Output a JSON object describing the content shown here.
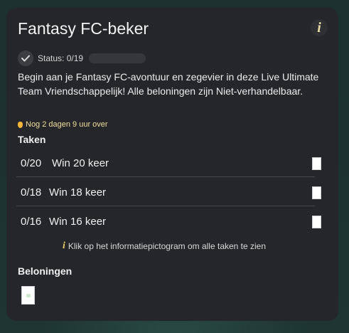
{
  "header": {
    "title": "Fantasy FC-beker",
    "info_icon": "i"
  },
  "status": {
    "label": "Status: 0/19",
    "progress_fraction": 0
  },
  "description": "Begin aan je Fantasy FC-avontuur en zegevier in deze Live Ultimate Team Vriendschappelijk! Alle beloningen zijn Niet-verhandelbaar.",
  "timer": {
    "text": "Nog 2 dagen 9 uur over"
  },
  "tasks": {
    "heading": "Taken",
    "items": [
      {
        "progress": "0/20",
        "name": "Win 20 keer"
      },
      {
        "progress": "0/18",
        "name": "Win 18 keer"
      },
      {
        "progress": "0/16",
        "name": "Win 16 keer"
      }
    ]
  },
  "hint": {
    "icon": "i",
    "text": "Klik op het informatiepictogram om alle taken te zien"
  },
  "rewards": {
    "heading": "Beloningen"
  },
  "colors": {
    "card": "#252629",
    "accent_gold": "#e6cf6f",
    "progress": "#7fd6a3"
  }
}
